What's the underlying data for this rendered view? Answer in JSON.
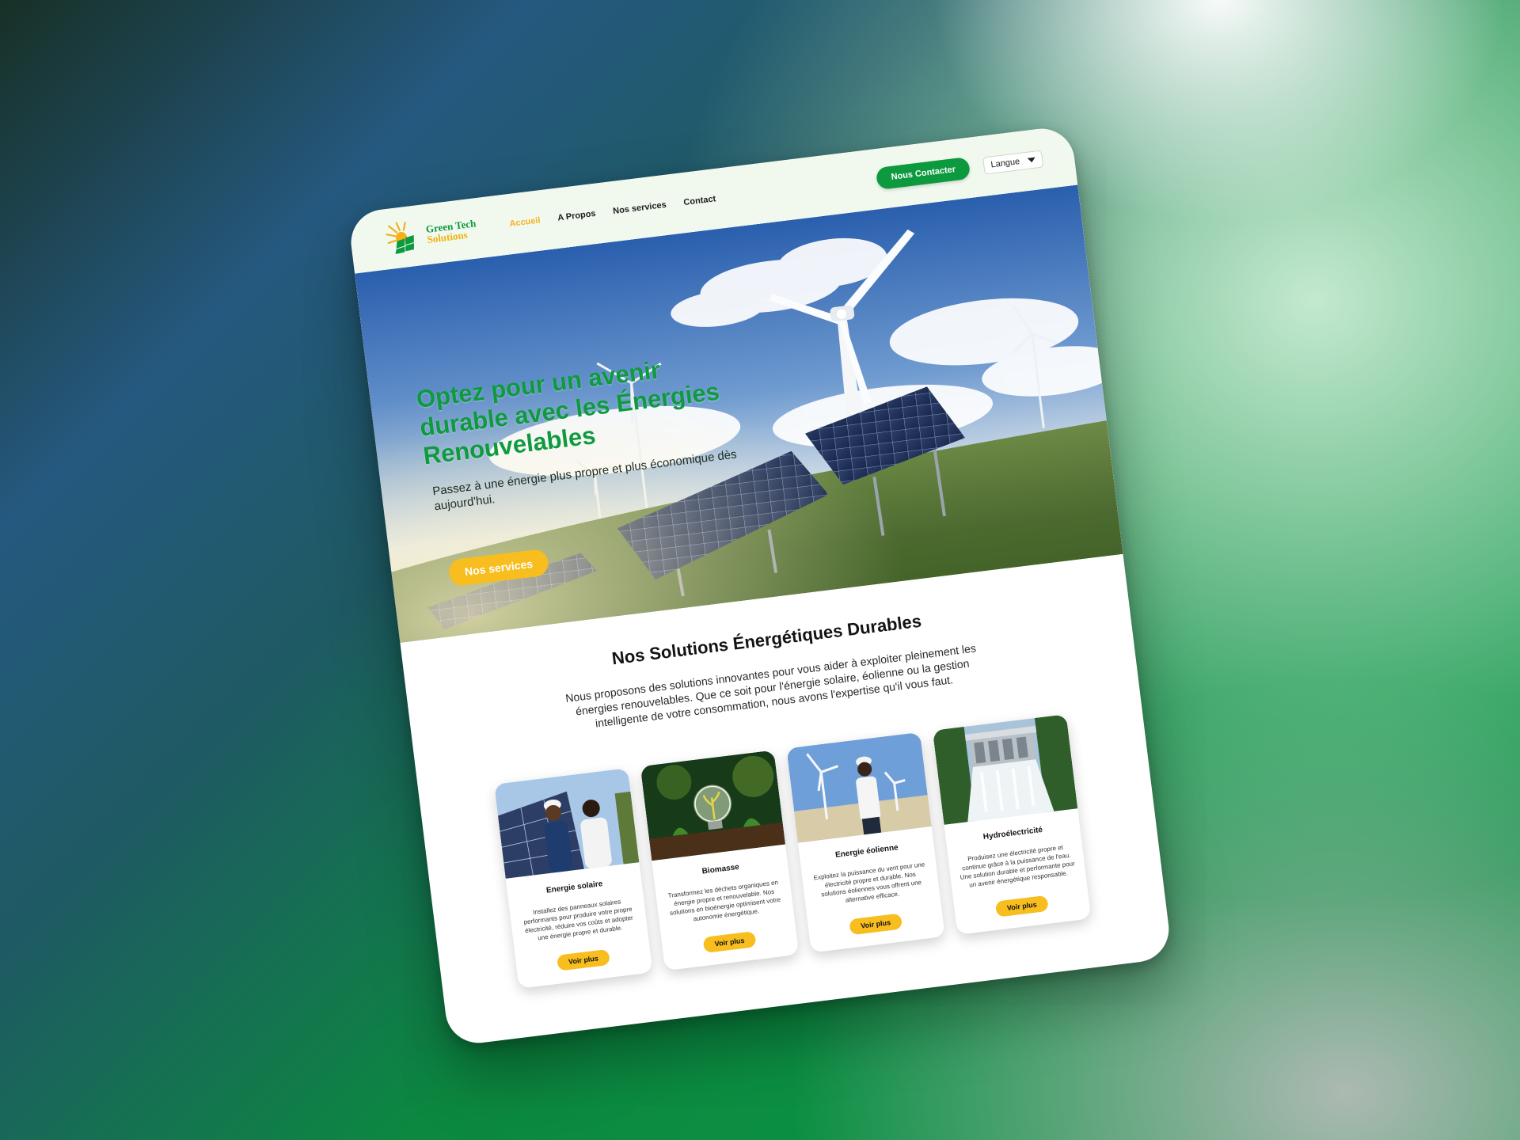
{
  "brand": {
    "line1": "Green Tech",
    "line2": "Solutions"
  },
  "nav": {
    "items": [
      "Accueil",
      "A Propos",
      "Nos services",
      "Contact"
    ],
    "active": "Accueil"
  },
  "header": {
    "contact_label": "Nous Contacter",
    "language_label": "Langue"
  },
  "hero": {
    "title": "Optez pour un avenir durable avec les Énergies Renouvelables",
    "subtitle": "Passez à une énergie plus propre et plus économique dès aujourd'hui.",
    "cta_label": "Nos services"
  },
  "solutions": {
    "title": "Nos Solutions Énergétiques Durables",
    "description": "Nous proposons des solutions innovantes pour vous aider à exploiter pleinement les énergies renouvelables. Que ce soit pour l'énergie solaire, éolienne ou la gestion intelligente de votre consommation, nous avons l'expertise qu'il vous faut.",
    "cards": [
      {
        "title": "Energie solaire",
        "text": "Installez des panneaux solaires performants pour produire votre propre électricité, réduire vos coûts et adopter une énergie propre et durable.",
        "button": "Voir plus"
      },
      {
        "title": "Biomasse",
        "text": "Transformez les déchets organiques en énergie propre et renouvelable. Nos solutions en bioénergie optimisent votre autonomie énergétique.",
        "button": "Voir plus"
      },
      {
        "title": "Energie éolienne",
        "text": "Exploitez la puissance du vent pour une électricité propre et durable. Nos solutions éoliennes vous offrent une alternative efficace.",
        "button": "Voir plus"
      },
      {
        "title": "Hydroélectricité",
        "text": "Produisez une électricité propre et continue grâce à la puissance de l'eau. Une solution durable et performante pour un avenir énergétique responsable.",
        "button": "Voir plus"
      }
    ]
  },
  "colors": {
    "brand_green": "#0d9a3f",
    "accent_yellow": "#f8bd1e",
    "header_bg": "#f1f9ef"
  }
}
